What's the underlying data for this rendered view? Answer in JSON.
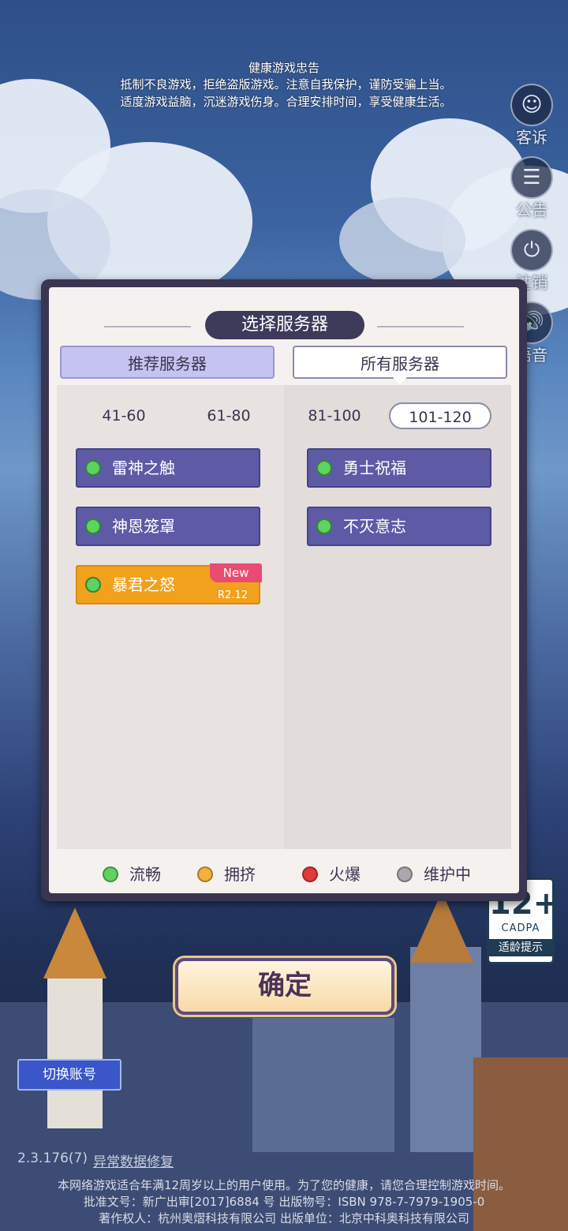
{
  "notice": {
    "title": "健康游戏忠告",
    "line1": "抵制不良游戏，拒绝盗版游戏。注意自我保护，谨防受骗上当。",
    "line2": "适度游戏益脑，沉迷游戏伤身。合理安排时间，享受健康生活。"
  },
  "side_menu": [
    {
      "label": "客诉",
      "icon": "headset-icon"
    },
    {
      "label": "公告",
      "icon": "notice-document-icon"
    },
    {
      "label": "注销",
      "icon": "power-icon"
    },
    {
      "label": "语音",
      "icon": "speaker-icon"
    }
  ],
  "dialog": {
    "title": "选择服务器",
    "tab_recommended": "推荐服务器",
    "tab_all": "所有服务器",
    "ranges": [
      "41-60",
      "61-80",
      "81-100",
      "101-120"
    ],
    "active_range": "101-120",
    "servers_left": [
      {
        "name": "雷神之触",
        "status": "流畅"
      },
      {
        "name": "神恩笼罩",
        "status": "流畅"
      },
      {
        "name": "暴君之怒",
        "status": "流畅",
        "tag": "New",
        "version": "R2.12"
      }
    ],
    "servers_right": [
      {
        "name": "勇士祝福",
        "status": "流畅"
      },
      {
        "name": "不灭意志",
        "status": "流畅"
      }
    ],
    "legend": [
      {
        "label": "流畅",
        "color": "#5fd25f"
      },
      {
        "label": "拥挤",
        "color": "#f2b13c"
      },
      {
        "label": "火爆",
        "color": "#e03a3a"
      },
      {
        "label": "维护中",
        "color": "#a9a9ad"
      }
    ]
  },
  "age_rating": {
    "number": "12+",
    "org": "CADPA",
    "tip": "适龄提示"
  },
  "confirm_label": "确定",
  "switch_account_label": "切换账号",
  "version": "2.3.176(7)",
  "repair_link": "异常数据修复",
  "footer": {
    "line1": "本网络游戏适合年满12周岁以上的用户使用。为了您的健康，请您合理控制游戏时间。",
    "line2": "批准文号：新广出审[2017]6884 号  出版物号：ISBN 978-7-7979-1905-0",
    "line3": "著作权人：杭州奥熠科技有限公司  出版单位：北京中科奥科技有限公司"
  }
}
